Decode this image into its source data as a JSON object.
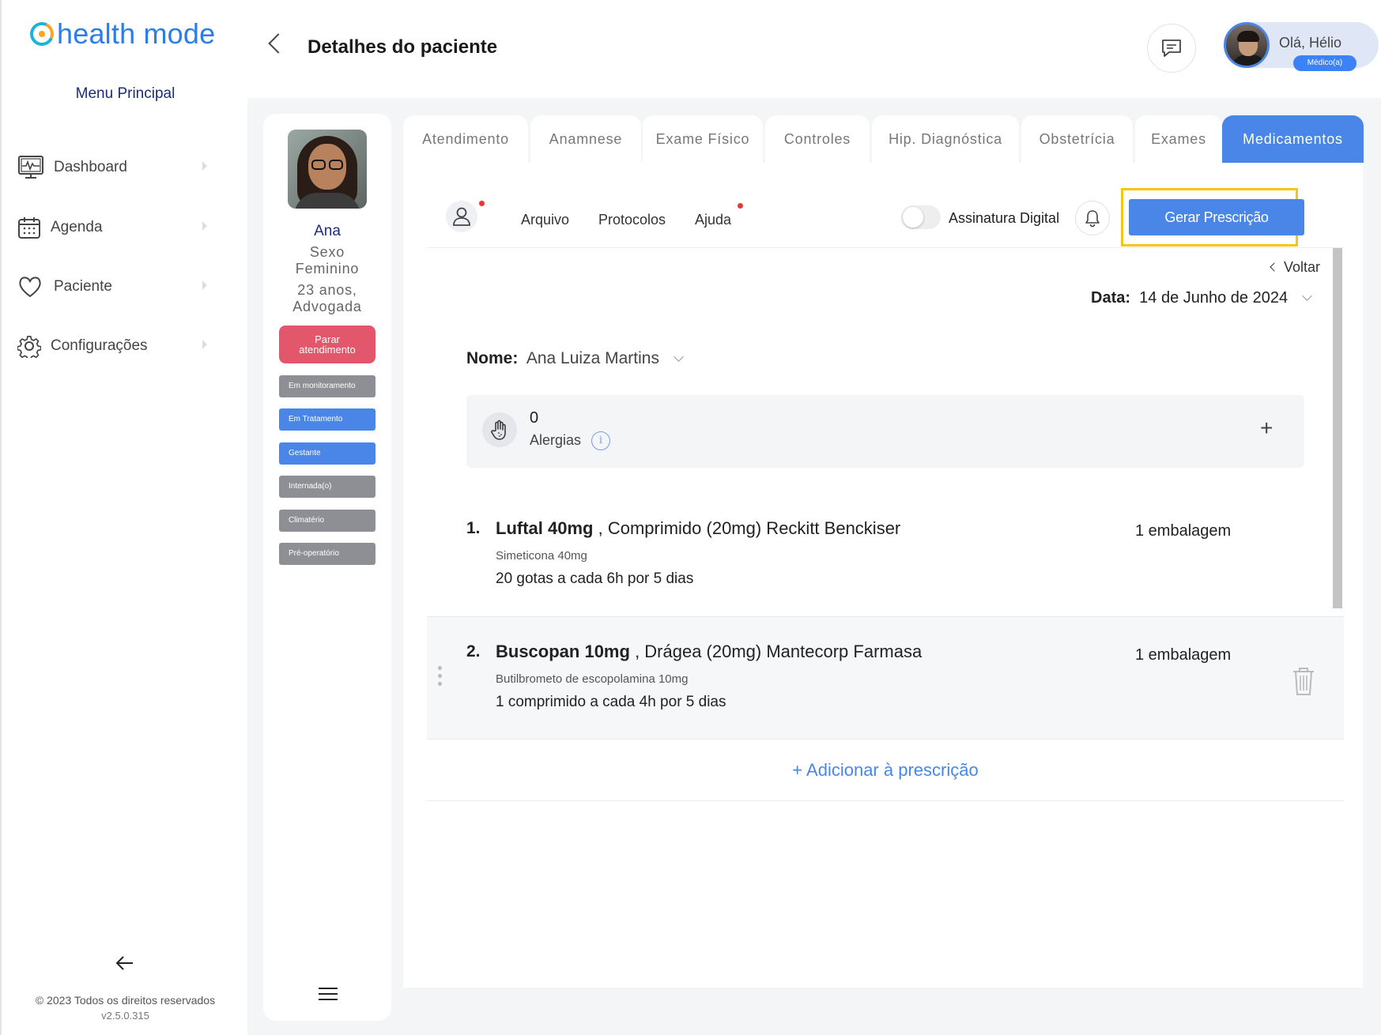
{
  "app": {
    "logo_text": "health mode",
    "brand_color": "#2b7de9"
  },
  "sidebar": {
    "menu_title": "Menu Principal",
    "items": [
      {
        "label": "Dashboard",
        "icon": "monitor-pulse-icon"
      },
      {
        "label": "Agenda",
        "icon": "calendar-icon"
      },
      {
        "label": "Paciente",
        "icon": "heart-icon"
      },
      {
        "label": "Configurações",
        "icon": "gear-icon"
      }
    ],
    "copyright": "© 2023 Todos os direitos reservados",
    "version": "v2.5.0.315"
  },
  "header": {
    "title": "Detalhes do paciente",
    "greeting": "Olá, Hélio",
    "role": "Médico(a)"
  },
  "patient": {
    "name": "Ana",
    "sex_line1": "Sexo",
    "sex_line2": "Feminino",
    "age": "23 anos,",
    "occupation": "Advogada",
    "stop_line1": "Parar",
    "stop_line2": "atendimento",
    "statuses": [
      {
        "label": "Em monitoramento",
        "active": false
      },
      {
        "label": "Em Tratamento",
        "active": true
      },
      {
        "label": "Gestante",
        "active": true
      },
      {
        "label": "Internada(o)",
        "active": false
      },
      {
        "label": "Climatério",
        "active": false
      },
      {
        "label": "Pré-operatório",
        "active": false
      }
    ]
  },
  "tabs": [
    {
      "label": "Atendimento",
      "active": false
    },
    {
      "label": "Anamnese",
      "active": false
    },
    {
      "label": "Exame Físico",
      "active": false
    },
    {
      "label": "Controles",
      "active": false
    },
    {
      "label": "Hip. Diagnóstica",
      "active": false
    },
    {
      "label": "Obstetrícia",
      "active": false
    },
    {
      "label": "Exames",
      "active": false
    },
    {
      "label": "Medicamentos",
      "active": true
    }
  ],
  "toolbar": {
    "arquivo": "Arquivo",
    "protocolos": "Protocolos",
    "ajuda": "Ajuda",
    "digital_signature": "Assinatura Digital",
    "digital_signature_enabled": false,
    "generate_button": "Gerar Prescrição"
  },
  "prescription": {
    "back_label": "Voltar",
    "date_label": "Data:",
    "date_value": "14 de Junho de 2024",
    "name_label": "Nome:",
    "name_value": "Ana Luiza Martins",
    "allergies_count": "0",
    "allergies_label": "Alergias",
    "medications": [
      {
        "number": "1.",
        "name": "Luftal 40mg",
        "details": ", Comprimido (20mg) Reckitt Benckiser",
        "generic": "Simeticona 40mg",
        "dosage": "20 gotas a cada 6h por 5 dias",
        "quantity": "1 embalagem"
      },
      {
        "number": "2.",
        "name": "Buscopan 10mg",
        "details": ", Drágea (20mg) Mantecorp Farmasa",
        "generic": "Butilbrometo de escopolamina 10mg",
        "dosage": "1 comprimido a cada 4h por 5 dias",
        "quantity": "1 embalagem"
      }
    ],
    "add_label": "+ Adicionar à prescrição"
  }
}
